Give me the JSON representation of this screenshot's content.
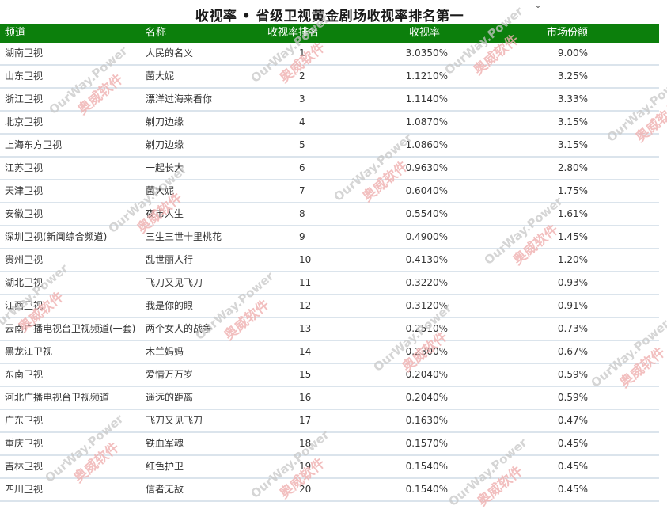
{
  "report": {
    "title": "收视率 • 省级卫视黄金剧场收视率排名第一",
    "columns": [
      "频道",
      "名称",
      "收视率排名",
      "收视率",
      "市场份额"
    ],
    "rows": [
      [
        "湖南卫视",
        "人民的名义",
        "1",
        "3.0350%",
        "9.00%"
      ],
      [
        "山东卫视",
        "菌大妮",
        "2",
        "1.1210%",
        "3.25%"
      ],
      [
        "浙江卫视",
        "漂洋过海来看你",
        "3",
        "1.1140%",
        "3.33%"
      ],
      [
        "北京卫视",
        "剃刀边缘",
        "4",
        "1.0870%",
        "3.15%"
      ],
      [
        "上海东方卫视",
        "剃刀边缘",
        "5",
        "1.0860%",
        "3.15%"
      ],
      [
        "江苏卫视",
        "一起长大",
        "6",
        "0.9630%",
        "2.80%"
      ],
      [
        "天津卫视",
        "菌大妮",
        "7",
        "0.6040%",
        "1.75%"
      ],
      [
        "安徽卫视",
        "夜市人生",
        "8",
        "0.5540%",
        "1.61%"
      ],
      [
        "深圳卫视(新闻综合频道)",
        "三生三世十里桃花",
        "9",
        "0.4900%",
        "1.45%"
      ],
      [
        "贵州卫视",
        "乱世丽人行",
        "10",
        "0.4130%",
        "1.20%"
      ],
      [
        "湖北卫视",
        "飞刀又见飞刀",
        "11",
        "0.3220%",
        "0.93%"
      ],
      [
        "江西卫视",
        "我是你的眼",
        "12",
        "0.3120%",
        "0.91%"
      ],
      [
        "云南广播电视台卫视频道(一套)",
        "两个女人的战争",
        "13",
        "0.2510%",
        "0.73%"
      ],
      [
        "黑龙江卫视",
        "木兰妈妈",
        "14",
        "0.2300%",
        "0.67%"
      ],
      [
        "东南卫视",
        "爱情万万岁",
        "15",
        "0.2040%",
        "0.59%"
      ],
      [
        "河北广播电视台卫视频道",
        "遥远的距离",
        "16",
        "0.2040%",
        "0.59%"
      ],
      [
        "广东卫视",
        "飞刀又见飞刀",
        "17",
        "0.1630%",
        "0.47%"
      ],
      [
        "重庆卫视",
        "铁血军魂",
        "18",
        "0.1570%",
        "0.45%"
      ],
      [
        "吉林卫视",
        "红色护卫",
        "19",
        "0.1540%",
        "0.45%"
      ],
      [
        "四川卫视",
        "信者无敌",
        "20",
        "0.1540%",
        "0.45%"
      ]
    ]
  },
  "watermark": {
    "text_en": "OurWay.Power",
    "text_cn": "奥威软件"
  },
  "icons": {
    "collapse": "chevron-down-icon"
  },
  "colors": {
    "header_bg": "#0c7f0c",
    "row_border": "#dbe4ec",
    "wm_en": "#c8c8c8",
    "wm_cn": "#f0b0b0"
  }
}
